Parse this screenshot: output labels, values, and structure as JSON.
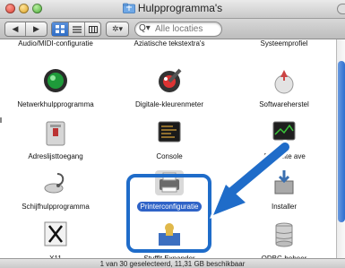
{
  "window": {
    "title": "Hulpprogramma's"
  },
  "toolbar": {
    "back_forward": [
      "◀",
      "▶"
    ],
    "view_modes": [
      "icon-view",
      "list-view",
      "column-view"
    ],
    "action_menu": "✲▾",
    "search_placeholder": "Alle locaties",
    "search_icon": "Q▾"
  },
  "top_row_labels": [
    "Audio/MIDI-configuratie",
    "Aziatische tekstextra's",
    "Systeemprofiel"
  ],
  "items": [
    {
      "label": "Netwerkhulpprogramma",
      "icon": "network-utility-icon"
    },
    {
      "label": "Digitale-kleurenmeter",
      "icon": "color-meter-icon"
    },
    {
      "label": "Softwareherstel",
      "icon": "software-restore-icon"
    },
    {
      "label": "Adreslijsttoegang",
      "icon": "directory-access-icon"
    },
    {
      "label": "Console",
      "icon": "console-icon"
    },
    {
      "label": "Activiteitenweergave",
      "icon": "activity-monitor-icon",
      "partial": "Ac viteite   ave"
    },
    {
      "label": "Schijfhulpprogramma",
      "icon": "disk-utility-icon"
    },
    {
      "label": "Printerconfiguratie",
      "icon": "printer-icon",
      "selected": true
    },
    {
      "label": "Installer",
      "icon": "installer-icon"
    },
    {
      "label": "X11",
      "icon": "x11-icon"
    },
    {
      "label": "StuffIt Expander",
      "icon": "stuffit-icon"
    },
    {
      "label": "ODBC-beheer",
      "icon": "odbc-icon"
    }
  ],
  "status": "1 van 30 geselecteerd, 11,31 GB beschikbaar",
  "colors": {
    "selection": "#2f63c7",
    "highlight_border": "#1f6cc9",
    "arrow": "#1f6cc9"
  }
}
